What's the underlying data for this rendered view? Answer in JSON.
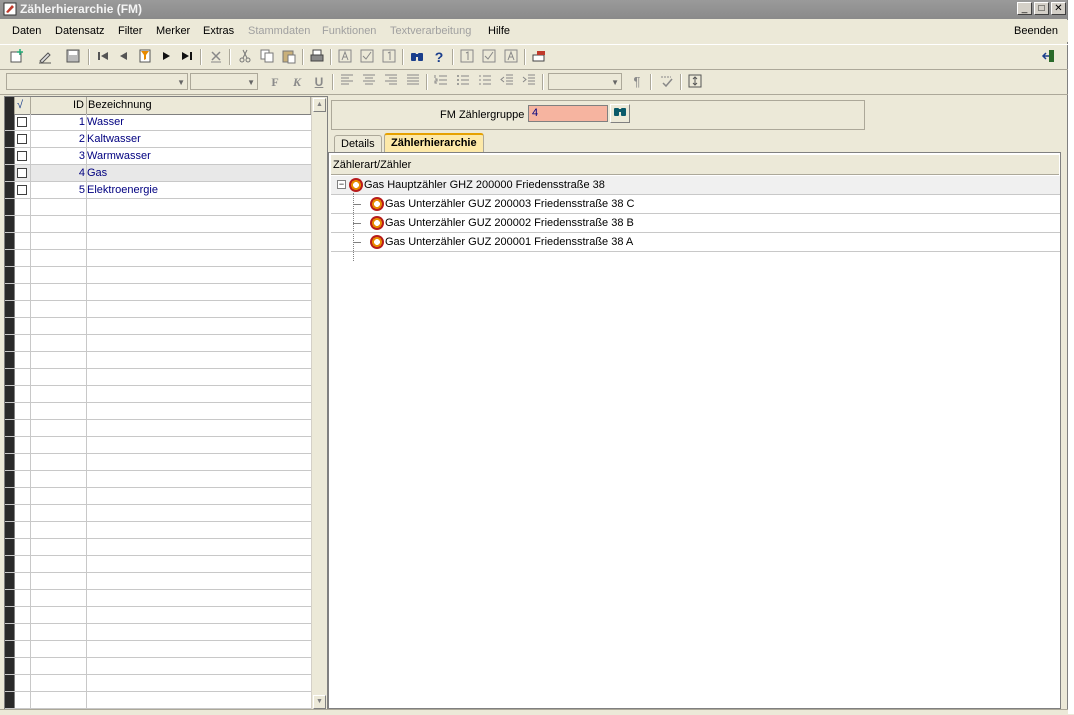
{
  "window": {
    "title": "Zählerhierarchie (FM)",
    "buttons": [
      "_",
      "□",
      "✕"
    ]
  },
  "menu": {
    "items": [
      {
        "label": "Daten",
        "enabled": true
      },
      {
        "label": "Datensatz",
        "enabled": true
      },
      {
        "label": "Filter",
        "enabled": true
      },
      {
        "label": "Merker",
        "enabled": true
      },
      {
        "label": "Extras",
        "enabled": true
      },
      {
        "label": "Stammdaten",
        "enabled": false
      },
      {
        "label": "Funktionen",
        "enabled": false
      },
      {
        "label": "Textverarbeitung",
        "enabled": false
      },
      {
        "label": "Hilfe",
        "enabled": true
      }
    ],
    "exit_label": "Beenden"
  },
  "format_toolbar": {
    "bold": "F",
    "italic": "K",
    "underline": "U",
    "pilcrow": "¶"
  },
  "grid": {
    "headers": {
      "check": "√",
      "id": "ID",
      "name": "Bezeichnung"
    },
    "rows": [
      {
        "id": "1",
        "name": "Wasser",
        "selected": false
      },
      {
        "id": "2",
        "name": "Kaltwasser",
        "selected": false
      },
      {
        "id": "3",
        "name": "Warmwasser",
        "selected": false
      },
      {
        "id": "4",
        "name": "Gas",
        "selected": true
      },
      {
        "id": "5",
        "name": "Elektroenergie",
        "selected": false
      }
    ]
  },
  "detail": {
    "group_label": "FM Zählergruppe",
    "group_value": "4",
    "tabs": [
      {
        "label": "Details",
        "active": false
      },
      {
        "label": "Zählerhierarchie",
        "active": true
      }
    ],
    "tree_header": "Zählerart/Zähler",
    "tree": {
      "root": "Gas Hauptzähler GHZ 200000 Friedensstraße 38",
      "children": [
        "Gas Unterzähler GUZ 200003 Friedensstraße 38 C",
        "Gas Unterzähler GUZ 200002 Friedensstraße 38 B",
        "Gas Unterzähler GUZ 200001 Friedensstraße 38 A"
      ]
    }
  },
  "colors": {
    "highlight_field": "#f6b4a0",
    "active_tab": "#fde9a8",
    "meter_icon": "#b71c1c",
    "grid_text": "#000080"
  }
}
